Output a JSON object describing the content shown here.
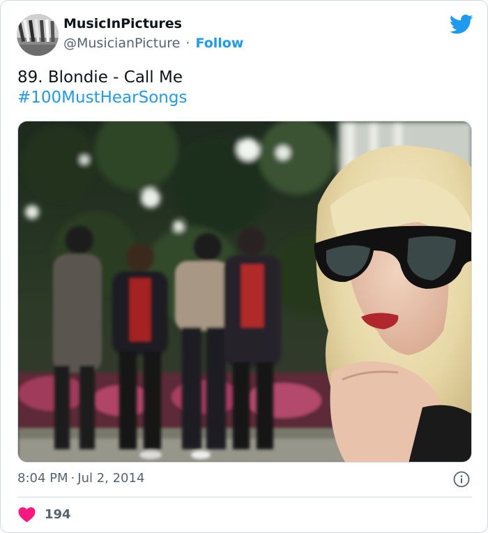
{
  "author": {
    "display_name": "MusicInPictures",
    "handle": "@MusicianPicture",
    "separator": "·",
    "follow_label": "Follow",
    "avatar_icon": "vinyl-records-photo"
  },
  "tweet": {
    "text": "89. Blondie - Call Me",
    "hashtag": "#100MustHearSongs",
    "media_description_icon": "band-photo"
  },
  "meta": {
    "time": "8:04 PM",
    "separator": "·",
    "date": "Jul 2, 2014"
  },
  "engagement": {
    "likes": "194"
  },
  "colors": {
    "accent": "#1d9bf0",
    "text_primary": "#0f1419",
    "text_secondary": "#536471",
    "like": "#f91880",
    "border": "#cfd9de"
  },
  "icons": {
    "brand": "twitter-bird-icon",
    "info": "info-icon",
    "like": "heart-icon"
  }
}
